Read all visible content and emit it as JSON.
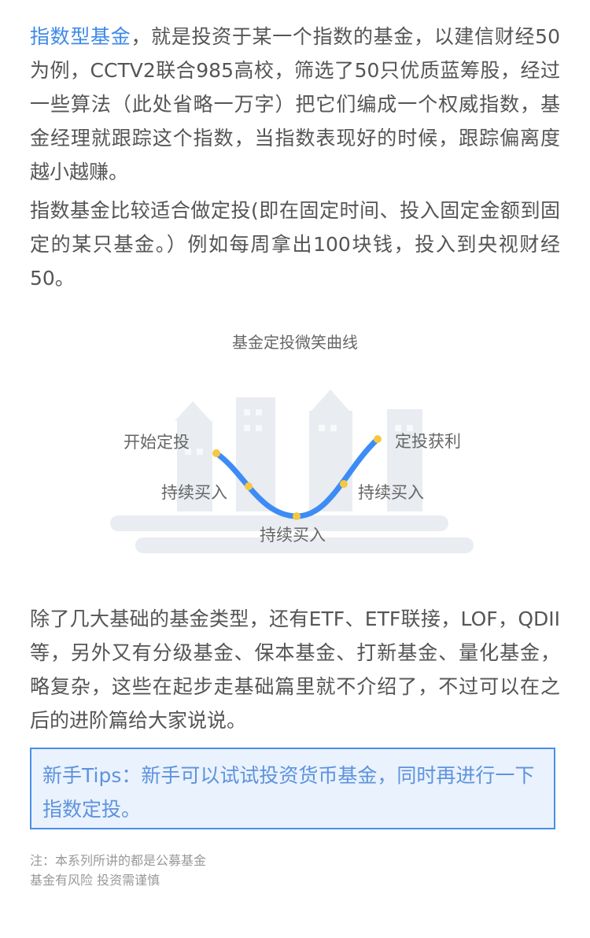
{
  "para1": {
    "highlight": "指数型基金",
    "rest": "，就是投资于某一个指数的基金，以建信财经50为例，CCTV2联合985高校，筛选了50只优质蓝筹股，经过一些算法（此处省略一万字）把它们编成一个权威指数，基金经理就跟踪这个指数，当指数表现好的时候，跟踪偏离度越小越赚。"
  },
  "para2": "指数基金比较适合做定投(即在固定时间、投入固定金额到固定的某只基金。）例如每周拿出100块钱，投入到央视财经50。",
  "illustration": {
    "title": "基金定投微笑曲线",
    "labels": {
      "start": "开始定投",
      "left_buy": "持续买入",
      "bottom_buy": "持续买入",
      "right_buy": "持续买入",
      "profit": "定投获利"
    },
    "colors": {
      "curve": "#3d8cf5",
      "dot": "#f5c842",
      "building": "#e9ecf1"
    }
  },
  "para3": "除了几大基础的基金类型，还有ETF、ETF联接，LOF，QDII等，另外又有分级基金、保本基金、打新基金、量化基金，略复杂，这些在起步走基础篇里就不介绍了，不过可以在之后的进阶篇给大家说说。",
  "tips": "新手Tips：新手可以试试投资货币基金，同时再进行一下指数定投。",
  "notes": [
    "注：本系列所讲的都是公募基金",
    "基金有风险 投资需谨慎"
  ]
}
